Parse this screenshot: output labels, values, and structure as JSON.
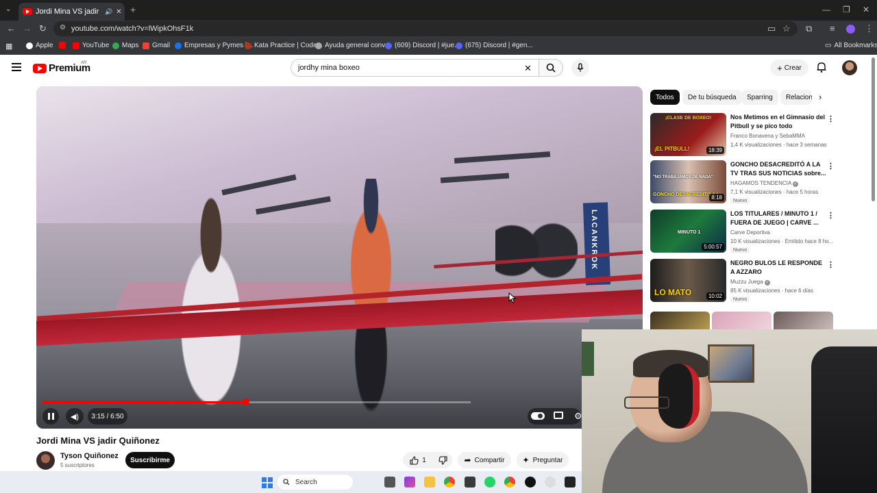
{
  "browser": {
    "tab_title": "Jordi Mina VS jadir Quiñonez",
    "url": "youtube.com/watch?v=lWipkOhsF1k",
    "bookmarks": [
      "Apple",
      "YouTube",
      "Maps",
      "Gmail",
      "Empresas y Pymes |...",
      "Kata Practice | Code...",
      "Ayuda general conv...",
      "(609) Discord | #jue...",
      "(675) Discord | #gen..."
    ],
    "all_bookmarks": "All Bookmarks"
  },
  "header": {
    "logo_text": "Premium",
    "logo_country": "AR",
    "search_query": "jordhy mina boxeo",
    "create_label": "Crear"
  },
  "player": {
    "current_time": "3:15",
    "duration": "6:50",
    "time_display": "3:15 / 6:50",
    "progress": 0.4756,
    "buffered": 1.0,
    "banner_text": "LACANKROK"
  },
  "video": {
    "title": "Jordi Mina VS jadir Quiñonez",
    "channel": "Tyson Quiñonez",
    "subscribers": "5 suscriptores",
    "subscribe_label": "Suscribirme",
    "likes": "1",
    "share_label": "Compartir",
    "ask_label": "Preguntar"
  },
  "chips": [
    "Todos",
    "De tu búsqueda",
    "Sparring",
    "Relacion"
  ],
  "recommendations": [
    {
      "title": "Nos Metimos en el Gimnasio del Pitbull y se pico todo",
      "channel": "Franco Bonavena y SebaMMA",
      "meta": "1,4 K visualizaciones · hace 3 semanas",
      "duration": "18:39",
      "new": "",
      "thumb_text_top": "¡CLASE DE BOXEO!",
      "thumb_text_bottom": "¡EL PITBULL!"
    },
    {
      "title": "GONCHO DESACREDITÓ A LA TV TRAS SUS NOTICIAS sobre...",
      "channel": "HAGAMOS TENDENCIA",
      "meta": "7,1 K visualizaciones · hace 5 horas",
      "duration": "8:18",
      "new": "Nuevo",
      "thumb_text_top": "\"NO TRABAJAMOS DE NADA\"",
      "thumb_text_bottom": "GONCHO DESACREDITÓ A L"
    },
    {
      "title": "LOS TITULARES / MINUTO 1 / FUERA DE JUEGO | CARVE ...",
      "channel": "Carve Deportiva",
      "meta": "10 K visualizaciones · Emitido hace 8 ho...",
      "duration": "5:00:57",
      "new": "Nuevo",
      "thumb_text_top": "",
      "thumb_text_bottom": "MINUTO 1"
    },
    {
      "title": "NEGRO BULOS LE RESPONDE A AZZARO",
      "channel": "Muzzu Juega",
      "meta": "85 K visualizaciones · hace 6 días",
      "duration": "10:02",
      "new": "Nuevo",
      "thumb_text_top": "",
      "thumb_text_bottom": "LO MATO"
    }
  ],
  "taskbar": {
    "search_label": "Search"
  },
  "colors": {
    "brand_red": "#ff0000",
    "progress_red": "#ff0000",
    "chrome_dark": "#35363a"
  }
}
